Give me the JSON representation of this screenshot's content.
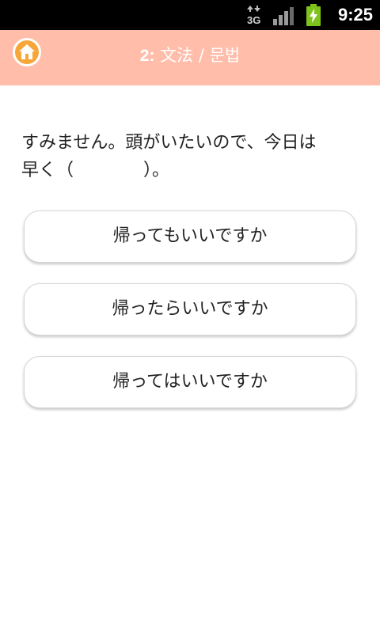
{
  "status_bar": {
    "network_label": "3G",
    "time": "9:25",
    "colors": {
      "background": "#000000",
      "battery": "#7ec31b"
    },
    "icons": [
      "3g-data-icon",
      "signal-strength-icon",
      "battery-charging-icon"
    ]
  },
  "header": {
    "number": "2:",
    "title": "文法 / 문법",
    "background": "#ffbdaa",
    "icon": "home-icon"
  },
  "question": {
    "text": "すみません。頭がいたいので、今日は\n早く（　　　　）。"
  },
  "answers": [
    {
      "label": "帰ってもいいですか"
    },
    {
      "label": "帰ったらいいですか"
    },
    {
      "label": "帰ってはいいですか"
    }
  ]
}
